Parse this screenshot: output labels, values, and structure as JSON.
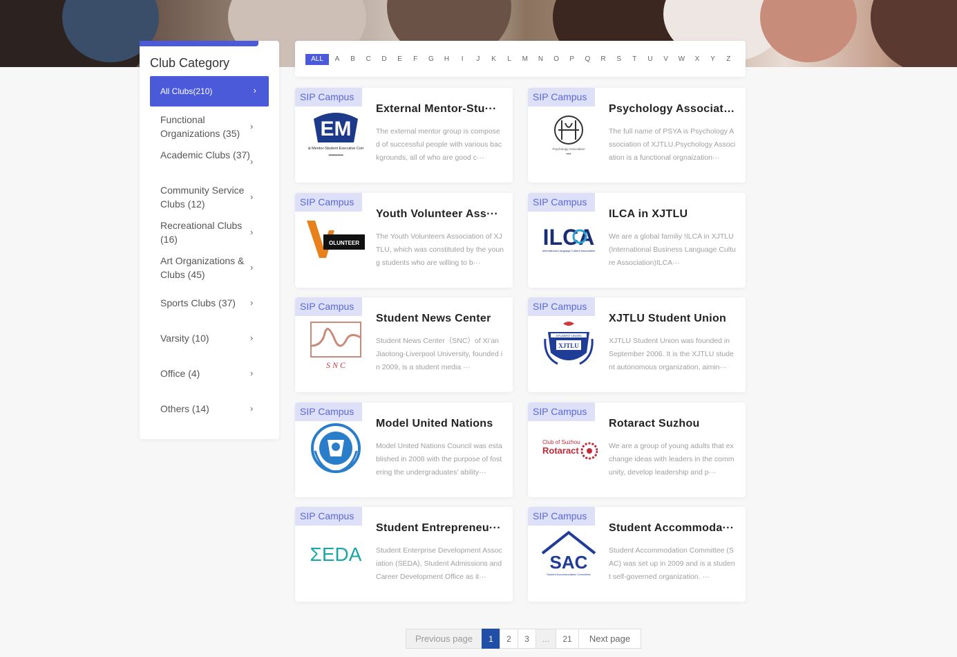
{
  "sidebar": {
    "title": "Club Category",
    "active": {
      "label": "All Clubs(210)"
    },
    "items": [
      {
        "label": "Functional Organizations (35)"
      },
      {
        "label": "Academic Clubs (37)"
      },
      {
        "label": "Community Service Clubs (12)"
      },
      {
        "label": "Recreational Clubs (16)"
      },
      {
        "label": "Art Organizations & Clubs (45)"
      },
      {
        "label": "Sports Clubs (37)"
      },
      {
        "label": "Varsity (10)"
      },
      {
        "label": "Office (4)"
      },
      {
        "label": "Others (14)"
      }
    ],
    "chevron": "›"
  },
  "alphabet": {
    "all": "ALL",
    "letters": [
      "A",
      "B",
      "C",
      "D",
      "E",
      "F",
      "G",
      "H",
      "I",
      "J",
      "K",
      "L",
      "M",
      "N",
      "O",
      "P",
      "Q",
      "R",
      "S",
      "T",
      "U",
      "V",
      "W",
      "X",
      "Y",
      "Z"
    ]
  },
  "cards": [
    {
      "tag": "SIP Campus",
      "title": "External Mentor-Stu···",
      "desc": "The external mentor group is composed of successful people with various backgrounds, all of who are good c···",
      "logo_icon": "em-logo-icon",
      "logo_text": "EM",
      "logo_sub": "External Mentor-Student Executive Committee"
    },
    {
      "tag": "SIP Campus",
      "title": "Psychology Associati···",
      "desc": "The full name of PSYA is Psychology Association of XJTLU.Psychology Association is a functional orgnaization···",
      "logo_icon": "psya-logo-icon",
      "logo_text": "",
      "logo_sub": "Psychology Association"
    },
    {
      "tag": "SIP Campus",
      "title": "Youth Volunteer Ass···",
      "desc": "The Youth Volunteers Association of XJTLU, which was constituted by the young students who are willing to b···",
      "logo_icon": "volunteer-logo-icon",
      "logo_text": "OLUNTEER",
      "logo_sub": ""
    },
    {
      "tag": "SIP Campus",
      "title": "ILCA in XJTLU",
      "desc": "We are a global familiy !ILCA in XJTLU (International Business Language Culture Association)ILCA···",
      "logo_icon": "ilca-logo-icon",
      "logo_text": "ILCA",
      "logo_sub": "International Language Culture Association"
    },
    {
      "tag": "SIP Campus",
      "title": "Student News Center",
      "desc": "Student News Center（SNC）of Xi’an Jiaotong-Liverpool University, founded in 2009, is a student media ···",
      "logo_icon": "snc-logo-icon",
      "logo_text": "S N C",
      "logo_sub": ""
    },
    {
      "tag": "SIP Campus",
      "title": "XJTLU Student Union",
      "desc": "XJTLU Student Union was founded in September 2006. It is the XJTLU student autonomous organization, aimin···",
      "logo_icon": "union-logo-icon",
      "logo_text": "XJTLU",
      "logo_sub": "STUDENT UNION"
    },
    {
      "tag": "SIP Campus",
      "title": "Model United Nations",
      "desc": "Model United Nations Council was established in 2008 with the purpose of fostering the undergraduates' ability···",
      "logo_icon": "mun-logo-icon",
      "logo_text": "",
      "logo_sub": ""
    },
    {
      "tag": "SIP Campus",
      "title": "Rotaract Suzhou",
      "desc": "We are a group of young adults that exchange ideas with leaders in the community, develop leadership and p···",
      "logo_icon": "rotaract-logo-icon",
      "logo_text": "Rotaract",
      "logo_sub": "Club of Suzhou"
    },
    {
      "tag": "SIP Campus",
      "title": "Student Entrepreneu···",
      "desc": "Student Enterprise Development Association (SEDA), Student Admissions and Career Development Office as it···",
      "logo_icon": "seda-logo-icon",
      "logo_text": "ΣEDA",
      "logo_sub": ""
    },
    {
      "tag": "SIP Campus",
      "title": "Student Accommoda···",
      "desc": "Student Accommodation Committee (SAC) was set up in 2009 and is a student self-governed organization. ···",
      "logo_icon": "sac-logo-icon",
      "logo_text": "SAC",
      "logo_sub": ""
    }
  ],
  "pagination": {
    "prev": "Previous page",
    "current": "1",
    "p2": "2",
    "p3": "3",
    "dots": "...",
    "last": "21",
    "next": "Next page"
  },
  "colors": {
    "accent": "#4a5ad8",
    "tag_bg": "#dde0f7",
    "page_active": "#1f4fa6"
  }
}
